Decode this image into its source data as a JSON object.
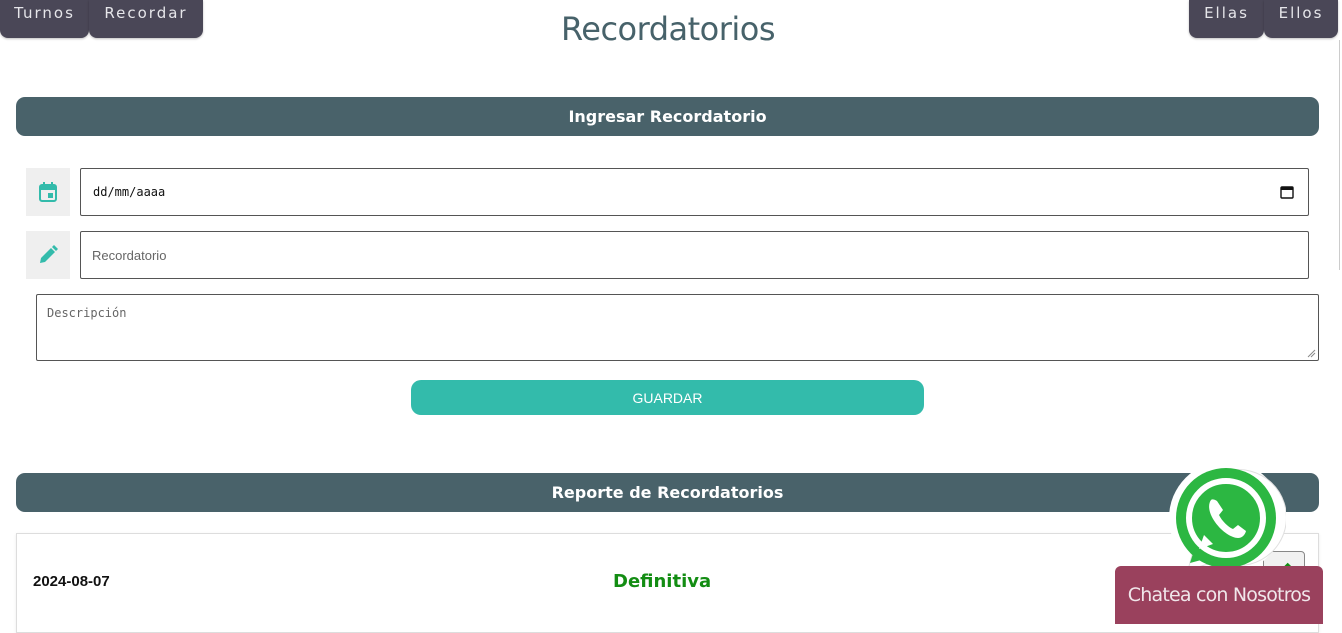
{
  "nav": {
    "left": [
      "Turnos",
      "Recordar"
    ],
    "right": [
      "Ellas",
      "Ellos"
    ]
  },
  "page": {
    "title": "Recordatorios"
  },
  "form": {
    "section_title": "Ingresar Recordatorio",
    "date_placeholder": "dd/mm/aaaa",
    "reminder_placeholder": "Recordatorio",
    "description_placeholder": "Descripción",
    "save_label": "GUARDAR"
  },
  "report": {
    "section_title": "Reporte de Recordatorios",
    "items": [
      {
        "date": "2024-08-07",
        "status": "Definitiva"
      }
    ]
  },
  "chat": {
    "label": "Chatea con Nosotros"
  },
  "icons": {
    "calendar": "calendar-icon",
    "pencil": "pencil-icon",
    "edit": "edit-icon",
    "whatsapp": "whatsapp-icon",
    "picker": "calendar-picker-icon"
  },
  "colors": {
    "nav_bg": "#4a4757",
    "section_bar": "#49626a",
    "accent": "#33bbab",
    "status_green": "#138d13",
    "chat_bg": "#9a415d",
    "title": "#47626a"
  }
}
